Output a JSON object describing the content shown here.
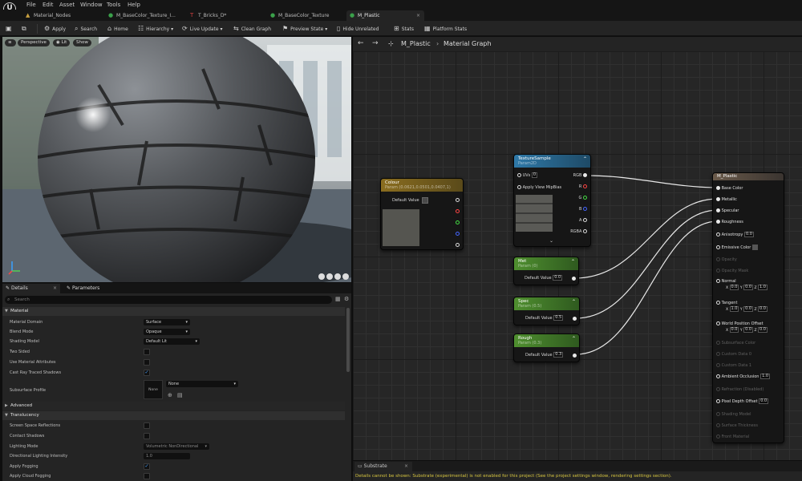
{
  "menu": {
    "items": [
      "File",
      "Edit",
      "Asset",
      "Window",
      "Tools",
      "Help"
    ]
  },
  "tabs": [
    {
      "label": "Material_Nodes",
      "icon": "material-nodes-icon",
      "color": "#c8a040"
    },
    {
      "label": "M_BaseColor_Texture_I...",
      "icon": "material-instance-icon",
      "color": "#3aa04a"
    },
    {
      "label": "T_Bricks_D*",
      "icon": "texture-icon",
      "color": "#d24040"
    },
    {
      "label": "M_BaseColor_Texture",
      "icon": "material-instance-icon",
      "color": "#3aa04a"
    },
    {
      "label": "M_Plastic",
      "icon": "material-icon",
      "color": "#3aa04a"
    }
  ],
  "toolbar": {
    "apply": "Apply",
    "search": "Search",
    "home": "Home",
    "hierarchy": "Hierarchy",
    "live_update": "Live Update",
    "clean_graph": "Clean Graph",
    "preview_state": "Preview State",
    "hide_unrelated": "Hide Unrelated",
    "stats": "Stats",
    "platform_stats": "Platform Stats"
  },
  "viewport": {
    "perspective": "Perspective",
    "lit": "Lit",
    "show": "Show"
  },
  "panel_tabs": {
    "details": "Details",
    "parameters": "Parameters"
  },
  "details": {
    "search_placeholder": "Search",
    "material_header": "Material",
    "rows": {
      "material_domain": {
        "label": "Material Domain",
        "value": "Surface"
      },
      "blend_mode": {
        "label": "Blend Mode",
        "value": "Opaque"
      },
      "shading_model": {
        "label": "Shading Model",
        "value": "Default Lit"
      },
      "two_sided": {
        "label": "Two Sided"
      },
      "use_material_attributes": {
        "label": "Use Material Attributes"
      },
      "cast_ray_traced_shadows": {
        "label": "Cast Ray Traced Shadows"
      },
      "subsurface_profile": {
        "label": "Subsurface Profile",
        "value": "None",
        "thumb": "None"
      }
    },
    "advanced_header": "Advanced",
    "translucency_header": "Translucency",
    "trans_rows": {
      "screen_space_reflections": "Screen Space Reflections",
      "contact_shadows": "Contact Shadows",
      "lighting_mode": {
        "label": "Lighting Mode",
        "value": "Volumetric NonDirectional"
      },
      "directional_lighting_intensity": {
        "label": "Directional Lighting Intensity",
        "value": "1.0"
      },
      "apply_fogging": "Apply Fogging",
      "apply_cloud_fogging": "Apply Cloud Fogging"
    }
  },
  "graph": {
    "breadcrumb_root": "M_Plastic",
    "breadcrumb_page": "Material Graph",
    "colour_node": {
      "title": "Colour",
      "sub": "Param (0.0621,0.0501,0.0407,1)",
      "default_label": "Default Value"
    },
    "texture_node": {
      "title": "TextureSample",
      "sub": "Param2D",
      "uvs": "UVs",
      "uvs_val": "0",
      "mipbias": "Apply View MipBias",
      "outputs": [
        "RGB",
        "R",
        "G",
        "B",
        "A",
        "RGBA"
      ]
    },
    "met_node": {
      "title": "Met",
      "sub": "Param (0)",
      "label": "Default Value",
      "value": "0.0"
    },
    "spec_node": {
      "title": "Spec",
      "sub": "Param (0.5)",
      "label": "Default Value",
      "value": "0.5"
    },
    "rough_node": {
      "title": "Rough",
      "sub": "Param (0.3)",
      "label": "Default Value",
      "value": "0.3"
    },
    "result_node": {
      "title": "M_Plastic",
      "base_color": "Base Color",
      "metallic": "Metallic",
      "specular": "Specular",
      "roughness": "Roughness",
      "anisotropy": "Anisotropy",
      "anisotropy_val": "0.0",
      "emissive": "Emissive Color",
      "opacity": "Opacity",
      "opacity_mask": "Opacity Mask",
      "normal": "Normal",
      "normal_vals": [
        "0.0",
        "0.0",
        "1.0"
      ],
      "tangent": "Tangent",
      "tangent_vals": [
        "1.0",
        "0.0",
        "0.0"
      ],
      "wpo": "World Position Offset",
      "wpo_vals": [
        "0.0",
        "0.0",
        "0.0"
      ],
      "subsurface_color": "Subsurface Color",
      "custom_data0": "Custom Data 0",
      "custom_data1": "Custom Data 1",
      "ambient_occlusion": "Ambient Occlusion",
      "ao_val": "1.0",
      "refraction": "Refraction (Disabled)",
      "pdo": "Pixel Depth Offset",
      "pdo_val": "0.0",
      "shading_model": "Shading Model",
      "surface_thickness": "Surface Thickness",
      "front_material": "Front Material"
    }
  },
  "bottom": {
    "tab": "Substrate",
    "message": "Details cannot be shown: Substrate (experimental) is not enabled for this project (See the project settings window, rendering settings section)."
  },
  "colors": {
    "accent": "#4aa3ff",
    "warning": "#d6c540",
    "colour_header": "#8a6d1f",
    "texture_header": "#2f79a8",
    "param_header": "#4f8f2f"
  }
}
